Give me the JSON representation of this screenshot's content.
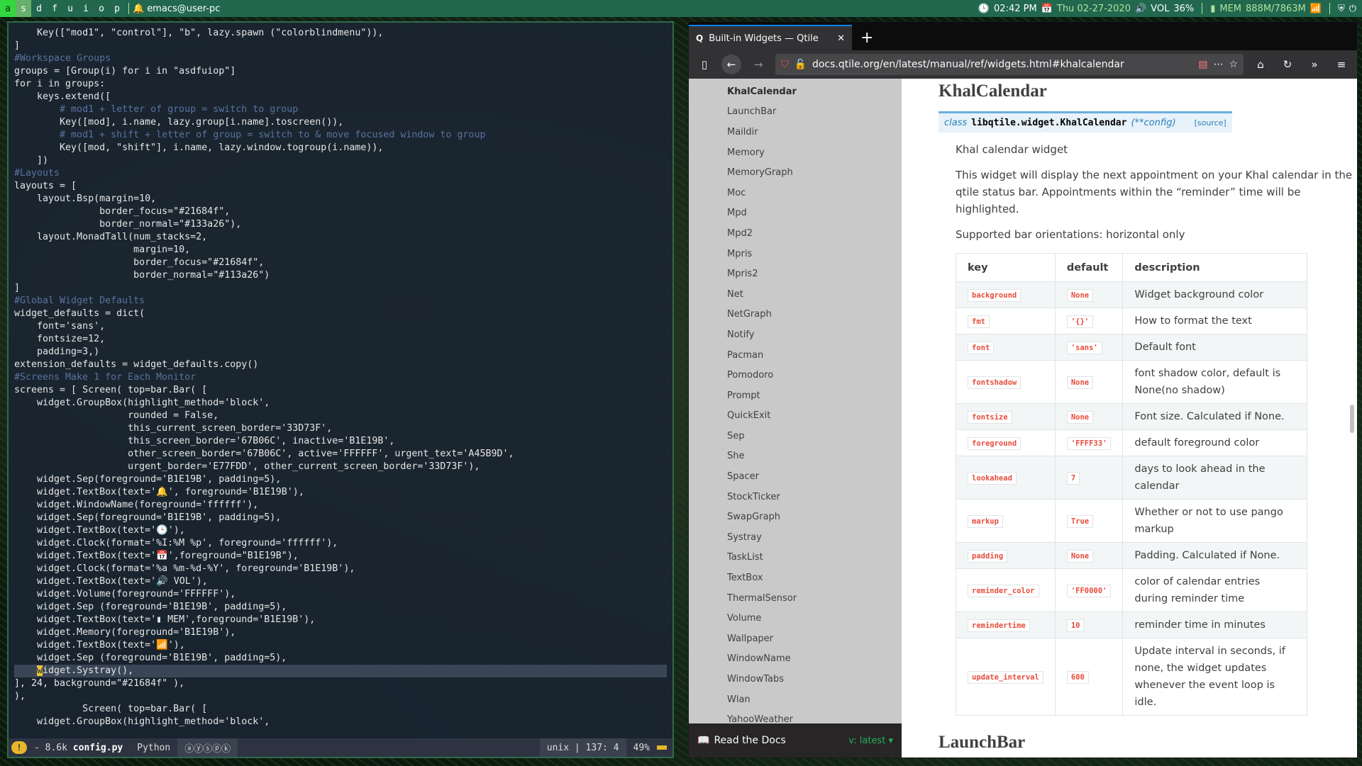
{
  "topbar": {
    "groups": [
      "a",
      "s",
      "d",
      "f",
      "u",
      "i",
      "o",
      "p"
    ],
    "window_name": "emacs@user-pc",
    "time_icon": "clock-icon",
    "time": "02:42 PM",
    "date": "Thu 02-27-2020",
    "vol_label": "VOL",
    "vol_value": "36%",
    "mem_label": "MEM",
    "mem_value": "888M/7863M"
  },
  "emacs": {
    "modeline": {
      "warning": "!",
      "size": "- 8.6k",
      "file": "config.py",
      "mode": "Python",
      "minor": "ⓐⓨⓢⓟⓚ",
      "eol": "unix",
      "position": "137: 4",
      "percent": "49%"
    }
  },
  "firefox": {
    "tab_title": "Built-in Widgets — Qtile",
    "tab_favicon": "Q",
    "url": "docs.qtile.org/en/latest/manual/ref/widgets.html#khalcalendar",
    "sidebar_items": [
      "KhalCalendar",
      "LaunchBar",
      "Maildir",
      "Memory",
      "MemoryGraph",
      "Moc",
      "Mpd",
      "Mpd2",
      "Mpris",
      "Mpris2",
      "Net",
      "NetGraph",
      "Notify",
      "Pacman",
      "Pomodoro",
      "Prompt",
      "QuickExit",
      "Sep",
      "She",
      "Spacer",
      "StockTicker",
      "SwapGraph",
      "Systray",
      "TaskList",
      "TextBox",
      "ThermalSensor",
      "Volume",
      "Wallpaper",
      "WindowName",
      "WindowTabs",
      "Wlan",
      "YahooWeather"
    ],
    "footer_label": "Read the Docs",
    "footer_version": "v: latest ▾",
    "doc": {
      "title": "KhalCalendar",
      "sig_class": "class",
      "sig_name": "libqtile.widget.KhalCalendar",
      "sig_args": "(**config)",
      "sig_source": "[source]",
      "summary": "Khal calendar widget",
      "body": "This widget will display the next appointment on your Khal calendar in the qtile status bar. Appointments within the “reminder” time will be highlighted.",
      "orientation": "Supported bar orientations: horizontal only",
      "table_headers": [
        "key",
        "default",
        "description"
      ],
      "rows": [
        {
          "key": "background",
          "default": "None",
          "description": "Widget background color"
        },
        {
          "key": "fmt",
          "default": "'{}'",
          "description": "How to format the text"
        },
        {
          "key": "font",
          "default": "'sans'",
          "description": "Default font"
        },
        {
          "key": "fontshadow",
          "default": "None",
          "description": "font shadow color, default is None(no shadow)"
        },
        {
          "key": "fontsize",
          "default": "None",
          "description": "Font size. Calculated if None."
        },
        {
          "key": "foreground",
          "default": "'FFFF33'",
          "description": "default foreground color"
        },
        {
          "key": "lookahead",
          "default": "7",
          "description": "days to look ahead in the calendar"
        },
        {
          "key": "markup",
          "default": "True",
          "description": "Whether or not to use pango markup"
        },
        {
          "key": "padding",
          "default": "None",
          "description": "Padding. Calculated if None."
        },
        {
          "key": "reminder_color",
          "default": "'FF0000'",
          "description": "color of calendar entries during reminder time"
        },
        {
          "key": "remindertime",
          "default": "10",
          "description": "reminder time in minutes"
        },
        {
          "key": "update_interval",
          "default": "600",
          "description": "Update interval in seconds, if none, the widget updates whenever the event loop is idle."
        }
      ],
      "next_title": "LaunchBar"
    }
  },
  "colors": {
    "bar_bg": "#21684f",
    "active_group": "#67b06c",
    "current_group": "#33d73f",
    "widget_fg": "#b1e19b"
  },
  "code": [
    "    Key([\"mod1\", \"control\"], \"b\", lazy.spawn (\"colorblindmenu\")),",
    "]",
    "#Workspace Groups",
    "groups = [Group(i) for i in \"asdfuiop\"]",
    "for i in groups:",
    "    keys.extend([",
    "        # mod1 + letter of group = switch to group",
    "        Key([mod], i.name, lazy.group[i.name].toscreen()),",
    "        # mod1 + shift + letter of group = switch to & move focused window to group",
    "        Key([mod, \"shift\"], i.name, lazy.window.togroup(i.name)),",
    "    ])",
    "#Layouts",
    "layouts = [",
    "    layout.Bsp(margin=10,",
    "               border_focus=\"#21684f\",",
    "               border_normal=\"#133a26\"),",
    "    layout.MonadTall(num_stacks=2,",
    "                     margin=10,",
    "                     border_focus=\"#21684f\",",
    "                     border_normal=\"#113a26\")",
    "]",
    "#Global Widget Defaults",
    "widget_defaults = dict(",
    "    font='sans',",
    "    fontsize=12,",
    "    padding=3,)",
    "extension_defaults = widget_defaults.copy()",
    "#Screens Make 1 for Each Monitor",
    "screens = [ Screen( top=bar.Bar( [",
    "    widget.GroupBox(highlight_method='block',",
    "                    rounded = False,",
    "                    this_current_screen_border='33D73F',",
    "                    this_screen_border='67B06C', inactive='B1E19B',",
    "                    other_screen_border='67B06C', active='FFFFFF', urgent_text='A45B9D',",
    "                    urgent_border='E77FDD', other_current_screen_border='33D73F'),",
    "    widget.Sep(foreground='B1E19B', padding=5),",
    "    widget.TextBox(text='🔔', foreground='B1E19B'),",
    "    widget.WindowName(foreground='ffffff'),",
    "    widget.Sep(foreground='B1E19B', padding=5),",
    "    widget.TextBox(text='🕒'),",
    "    widget.Clock(format='%I:%M %p', foreground='ffffff'),",
    "    widget.TextBox(text='📅',foreground=\"B1E19B\"),",
    "    widget.Clock(format='%a %m-%d-%Y', foreground='B1E19B'),",
    "    widget.TextBox(text='🔊 VOL'),",
    "    widget.Volume(foreground='FFFFFF'),",
    "    widget.Sep (foreground='B1E19B', padding=5),",
    "    widget.TextBox(text='▮ MEM',foreground='B1E19B'),",
    "    widget.Memory(foreground='B1E19B'),",
    "    widget.TextBox(text='📶'),",
    "    widget.Sep (foreground='B1E19B', padding=5),",
    "    widget.Systray(),",
    "], 24, background=\"#21684f\" ),",
    "),",
    "            Screen( top=bar.Bar( [",
    "    widget.GroupBox(highlight_method='block',"
  ],
  "highlight_line": 50
}
